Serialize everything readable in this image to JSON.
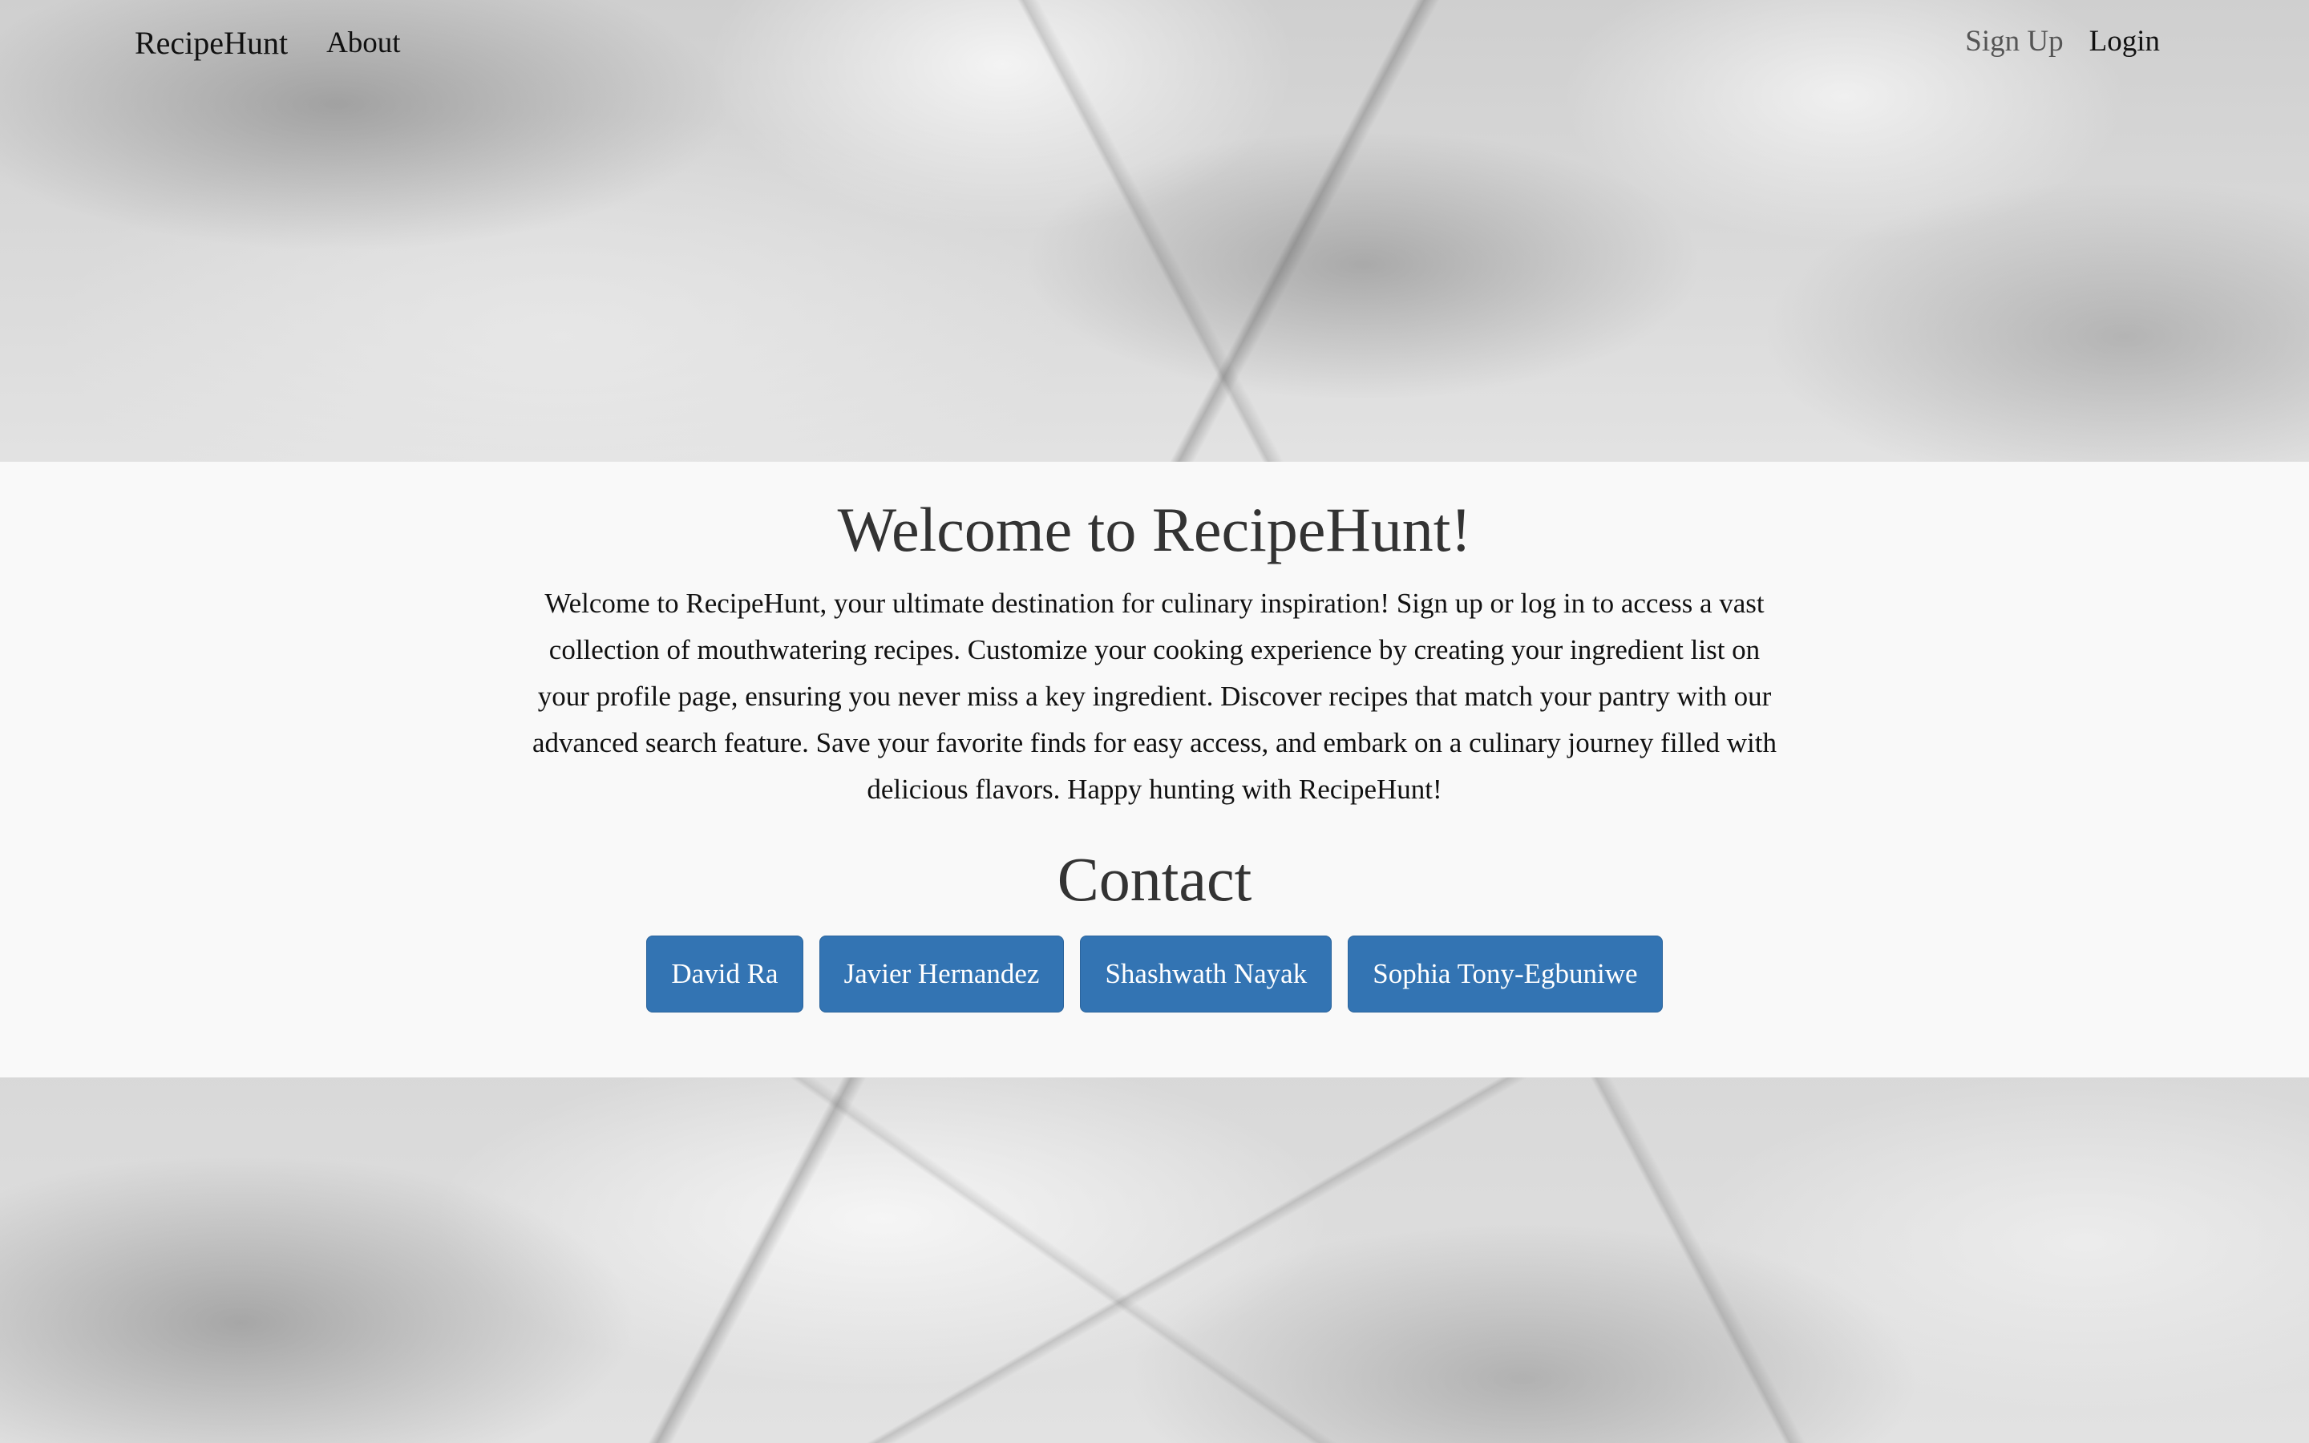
{
  "navbar": {
    "brand": "RecipeHunt",
    "about": "About",
    "sign_up": "Sign Up",
    "login": "Login"
  },
  "main": {
    "welcome_title": "Welcome to RecipeHunt!",
    "welcome_text": "Welcome to RecipeHunt, your ultimate destination for culinary inspiration! Sign up or log in to access a vast collection of mouthwatering recipes. Customize your cooking experience by creating your ingredient list on your profile page, ensuring you never miss a key ingredient. Discover recipes that match your pantry with our advanced search feature. Save your favorite finds for easy access, and embark on a culinary journey filled with delicious flavors. Happy hunting with RecipeHunt!",
    "contact_title": "Contact",
    "contacts": [
      {
        "label": "David Ra"
      },
      {
        "label": "Javier Hernandez"
      },
      {
        "label": "Shashwath Nayak"
      },
      {
        "label": "Sophia Tony-Egbuniwe"
      }
    ]
  },
  "colors": {
    "button_bg": "#3374b3",
    "panel_bg": "#f9f9f9"
  }
}
